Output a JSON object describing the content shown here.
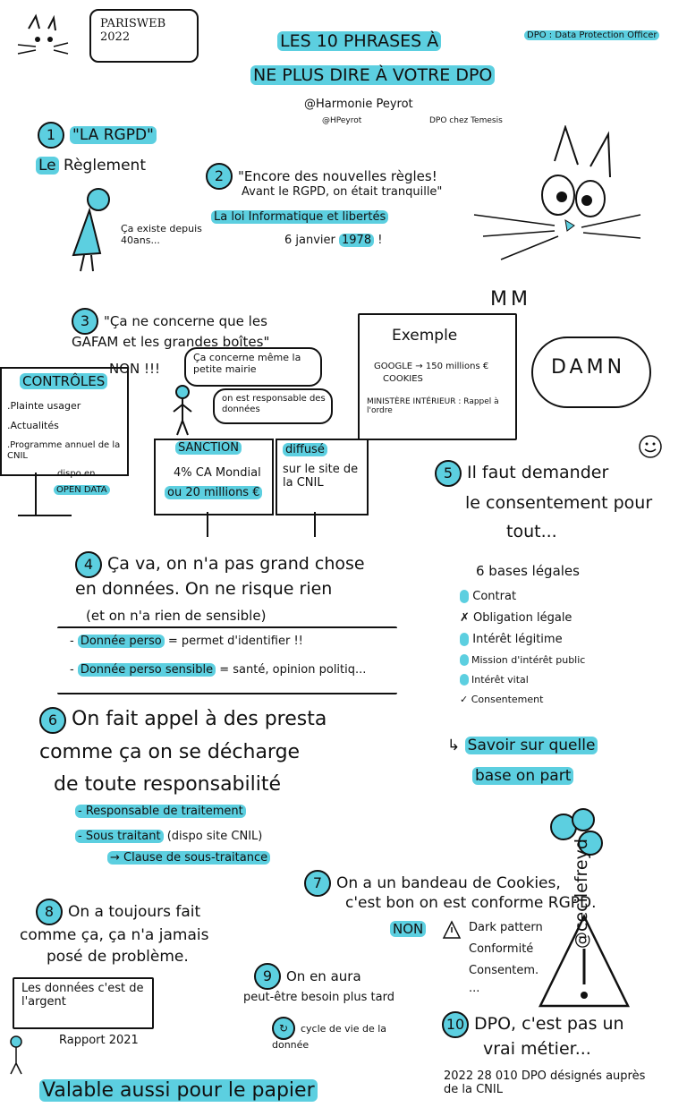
{
  "header": {
    "event": "PARISWEB 2022",
    "title_line1": "LES 10 PHRASES À",
    "title_line2": "NE PLUS DIRE À VOTRE DPO",
    "speaker": "@Harmonie Peyrot",
    "speaker_role": "DPO chez Temesis",
    "speaker_handle": "@HPeyrot",
    "dpo_definition": "DPO : Data Protection Officer"
  },
  "p1": {
    "number": "1",
    "quote": "\"LA RGPD\"",
    "correction_article": "Le",
    "correction_word": "Règlement",
    "bubble": "Ça existe depuis 40ans..."
  },
  "p2": {
    "number": "2",
    "quote": "\"Encore des nouvelles règles!",
    "line2": "Avant le RGPD, on était tranquille\"",
    "law": "La loi Informatique et libertés",
    "date_prefix": "6 janvier",
    "year": "1978",
    "date_suffix": "!"
  },
  "p3": {
    "number": "3",
    "quote": "\"Ça ne concerne que les GAFAM et les grandes boîtes\"",
    "answer": "NON !!!",
    "bubble_mairie": "Ça concerne même la petite mairie",
    "bubble_responsable": "on est responsable des données",
    "controles_title": "CONTRÔLES",
    "controles_items": [
      ".Plainte usager",
      ".Actualités",
      ".Programme annuel de la CNIL"
    ],
    "dispo": "dispo en",
    "opendata": "OPEN DATA",
    "sanction_title": "SANCTION",
    "sanction_line1": "4% CA Mondial",
    "sanction_line2": "ou 20 millions €",
    "diffuse_word": "diffusé",
    "diffuse_rest": "sur le site de la CNIL",
    "example_title": "Exemple",
    "example_line1": "GOOGLE → 150 millions €",
    "example_line2": "COOKIES",
    "example_line3": "MINISTÈRE INTÉRIEUR : Rappel à l'ordre",
    "damn": "DAMN",
    "mmm": "MM"
  },
  "p4": {
    "number": "4",
    "quote_line1": "Ça va, on n'a pas grand chose",
    "quote_line2": "en données. On ne risque rien",
    "quote_line3": "(et on n'a rien de sensible)",
    "def1_term": "Donnée perso",
    "def1_def": "= permet d'identifier !!",
    "def2_term": "Donnée perso sensible",
    "def2_def": "= santé, opinion politiq..."
  },
  "p5": {
    "number": "5",
    "quote_line1": "Il faut demander",
    "quote_line2": "le consentement pour",
    "quote_line3": "tout...",
    "bases_title": "6 bases légales",
    "bases": [
      "Contrat",
      "Obligation légale",
      "Intérêt légitime",
      "Mission d'intérêt public",
      "Intérêt vital",
      "Consentement"
    ],
    "conclusion_line1": "Savoir sur quelle",
    "conclusion_line2": "base on part"
  },
  "p6": {
    "number": "6",
    "quote_line1": "On fait appel à des presta",
    "quote_line2": "comme ça on se décharge",
    "quote_line3": "de toute responsabilité",
    "item1": "- Responsable de traitement",
    "item2": "- Sous traitant",
    "item2_note": "(dispo site CNIL)",
    "item3": "→ Clause de sous-traitance"
  },
  "p7": {
    "number": "7",
    "quote_line1": "On a un bandeau de Cookies,",
    "quote_line2": "c'est bon on est conforme RGPD.",
    "answer": "NON",
    "items": [
      "Dark pattern",
      "Conformité",
      "Consentem.",
      "..."
    ]
  },
  "p8": {
    "number": "8",
    "quote_line1": "On a toujours fait",
    "quote_line2": "comme ça, ça n'a jamais",
    "quote_line3": "posé de problème.",
    "box": "Les données c'est de l'argent",
    "rapport": "Rapport 2021"
  },
  "p9": {
    "number": "9",
    "quote_line1": "On en aura",
    "quote_line2": "peut-être besoin plus tard",
    "cycle": "cycle de vie de la donnée"
  },
  "p10": {
    "number": "10",
    "quote_line1": "DPO, c'est pas un",
    "quote_line2": "vrai métier...",
    "stat": "2022 28 010 DPO désignés auprès de la CNIL"
  },
  "footer": {
    "valable": "Valable aussi pour le papier",
    "signature": "@cecilefreyd"
  },
  "colors": {
    "accent": "#5ccfe0",
    "ink": "#111111"
  }
}
